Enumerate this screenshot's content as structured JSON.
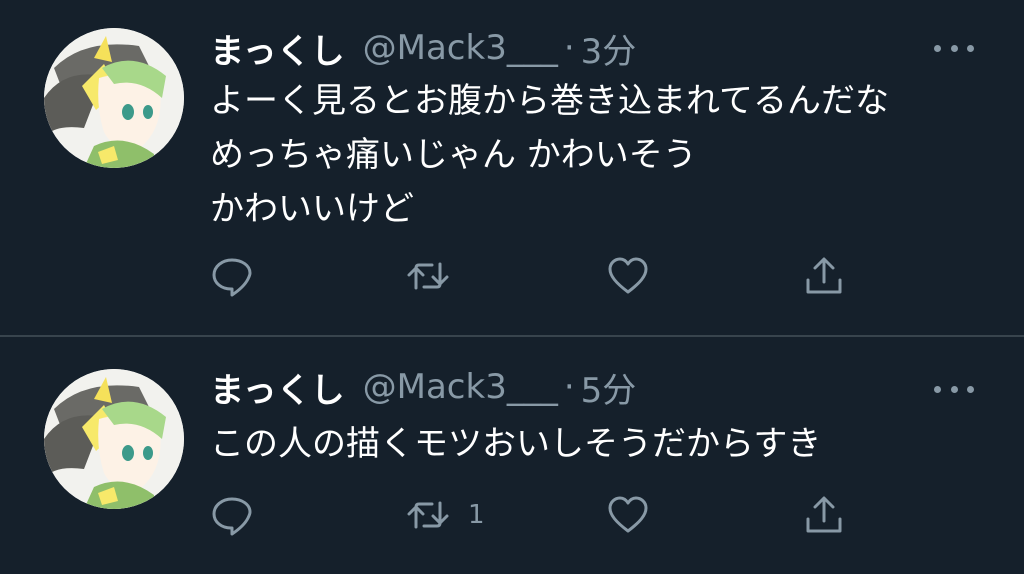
{
  "colors": {
    "background": "#15202b",
    "text": "#ffffff",
    "muted": "#8899a6",
    "divider": "#38444d"
  },
  "tweets": [
    {
      "name": "まっくし",
      "handle": "@Mack3___",
      "separator": "·",
      "time": "3分",
      "lines": [
        "よーく見るとお腹から巻き込まれてるんだな",
        "めっちゃ痛いじゃん かわいそう",
        "かわいいけど"
      ],
      "retweet_count": ""
    },
    {
      "name": "まっくし",
      "handle": "@Mack3___",
      "separator": "·",
      "time": "5分",
      "lines": [
        "この人の描くモツおいしそうだからすき"
      ],
      "retweet_count": "1"
    }
  ],
  "icons": {
    "reply": "speech-bubble-icon",
    "retweet": "retweet-icon",
    "like": "heart-icon",
    "share": "share-icon",
    "more": "ellipsis-icon"
  }
}
